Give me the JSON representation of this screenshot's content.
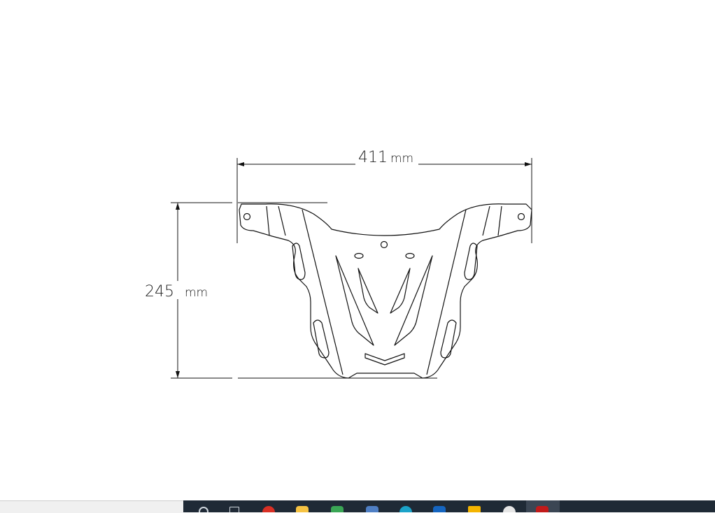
{
  "drawing": {
    "width_value": "411",
    "width_unit": "mm",
    "height_value": "245",
    "height_unit": "mm"
  },
  "taskbar": {
    "items": [
      {
        "icon": "search-icon",
        "color": "#cfd6dd"
      },
      {
        "icon": "task-view-icon",
        "color": "#cfd6dd"
      },
      {
        "icon": "chrome-icon",
        "color": "#d93025"
      },
      {
        "icon": "file-explorer-icon",
        "color": "#f6c343"
      },
      {
        "icon": "spreadsheet-icon",
        "color": "#3aa655"
      },
      {
        "icon": "document-icon",
        "color": "#4f7fc4"
      },
      {
        "icon": "edge-icon",
        "color": "#1ba3c9"
      },
      {
        "icon": "outlook-icon",
        "color": "#1565c0"
      },
      {
        "icon": "folder-icon",
        "color": "#f4b400"
      },
      {
        "icon": "record-icon",
        "color": "#e6e6e6"
      },
      {
        "icon": "pdf-reader-icon",
        "color": "#c21a1a"
      }
    ]
  }
}
